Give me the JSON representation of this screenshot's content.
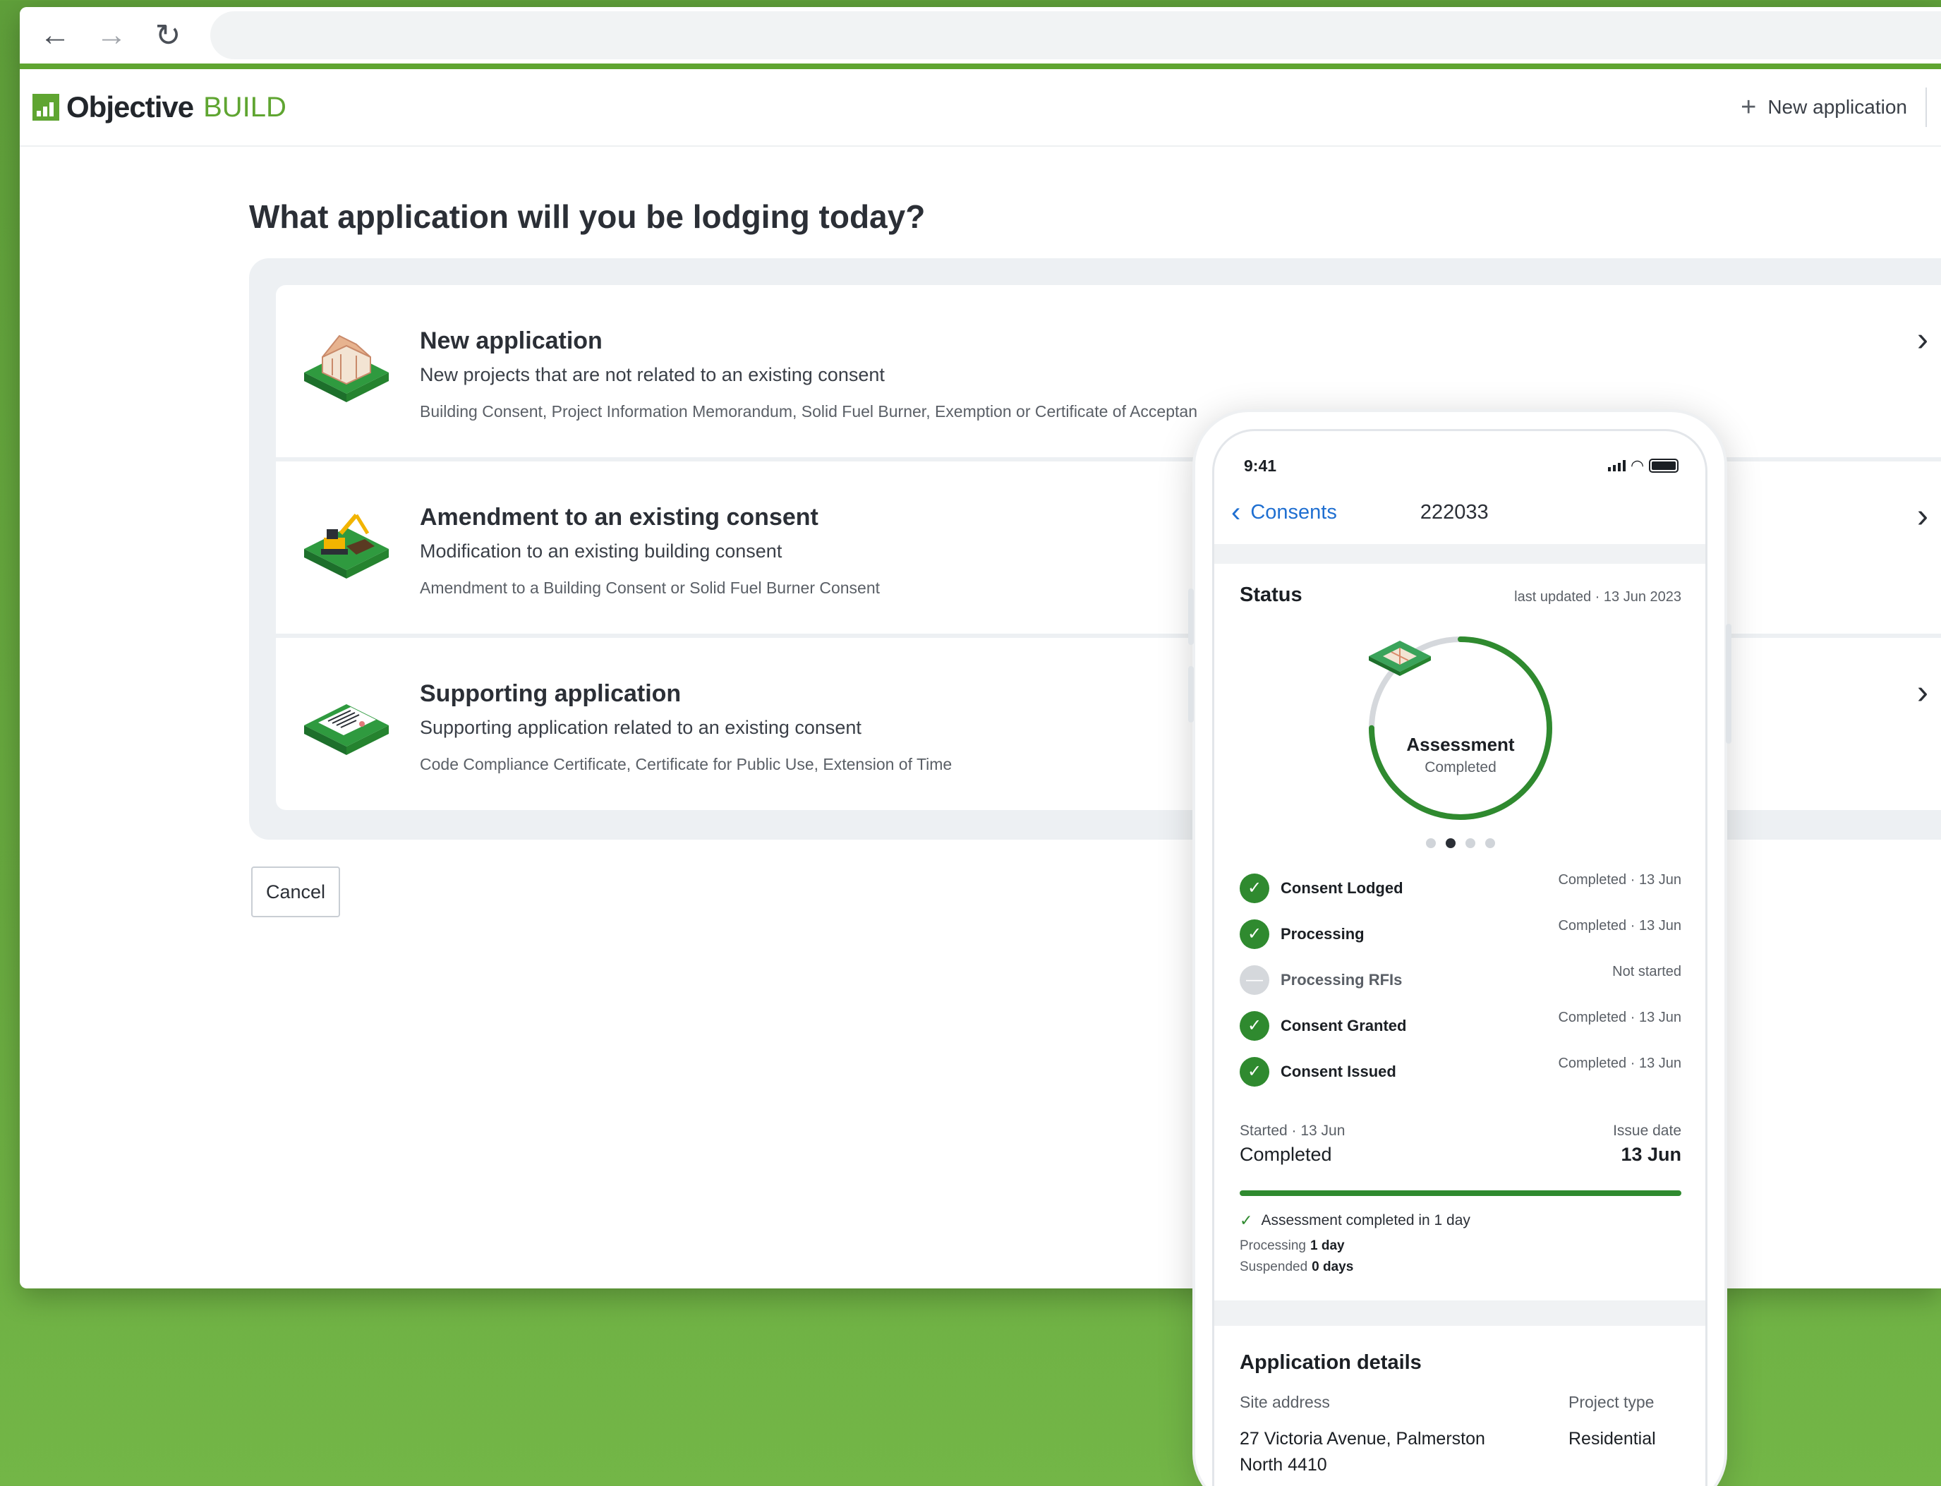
{
  "browser": {
    "nav": {
      "back_icon": "←",
      "forward_icon": "→",
      "reload_icon": "↻"
    }
  },
  "app": {
    "logo_word": "Objective",
    "logo_build": "BUILD",
    "header_action": "New application",
    "header_action_icon": "+"
  },
  "page": {
    "title": "What application will you be lodging today?",
    "cancel_label": "Cancel"
  },
  "cards": [
    {
      "title": "New application",
      "subtitle": "New projects that are not related to an existing consent",
      "list": "Building Consent, Project Information Memorandum, Solid Fuel Burner, Exemption or Certificate of Acceptan",
      "icon": "house-frame-icon"
    },
    {
      "title": "Amendment to an existing consent",
      "subtitle": "Modification to an existing building consent",
      "list": "Amendment to a Building Consent or Solid Fuel Burner Consent",
      "icon": "excavator-icon"
    },
    {
      "title": "Supporting application",
      "subtitle": "Supporting application related to an existing consent",
      "list": "Code Compliance Certificate, Certificate for Public Use, Extension of Time",
      "icon": "document-icon"
    }
  ],
  "chevron": "›",
  "phone": {
    "time": "9:41",
    "back_label": "Consents",
    "consent_number": "222033",
    "status_title": "Status",
    "last_updated": "last updated · 13 Jun 2023",
    "ring_label": "Assessment",
    "ring_sub": "Completed",
    "ring_progress": 0.75,
    "carousel_active": 2,
    "carousel_count": 4,
    "steps": [
      {
        "name": "Consent Lodged",
        "status": "Completed · 13 Jun",
        "done": true
      },
      {
        "name": "Processing",
        "status": "Completed · 13 Jun",
        "done": true
      },
      {
        "name": "Processing RFIs",
        "status": "Not started",
        "done": false
      },
      {
        "name": "Consent Granted",
        "status": "Completed · 13 Jun",
        "done": true
      },
      {
        "name": "Consent Issued",
        "status": "Completed · 13 Jun",
        "done": true
      }
    ],
    "timeline": {
      "started": "Started · 13 Jun",
      "state": "Completed",
      "issue_label": "Issue date",
      "issue_date": "13 Jun",
      "progress": 1.0
    },
    "assessment_line": "Assessment completed in 1 day",
    "processing_label": "Processing",
    "processing_value": "1 day",
    "suspended_label": "Suspended",
    "suspended_value": "0 days",
    "details": {
      "title": "Application details",
      "site_label": "Site address",
      "site_value": "27 Victoria Avenue, Palmerston North 4410",
      "type_label": "Project type",
      "type_value": "Residential"
    }
  },
  "colors": {
    "brand_green": "#5fa531",
    "status_green": "#2f8a2f",
    "link_blue": "#1f6fd1"
  }
}
